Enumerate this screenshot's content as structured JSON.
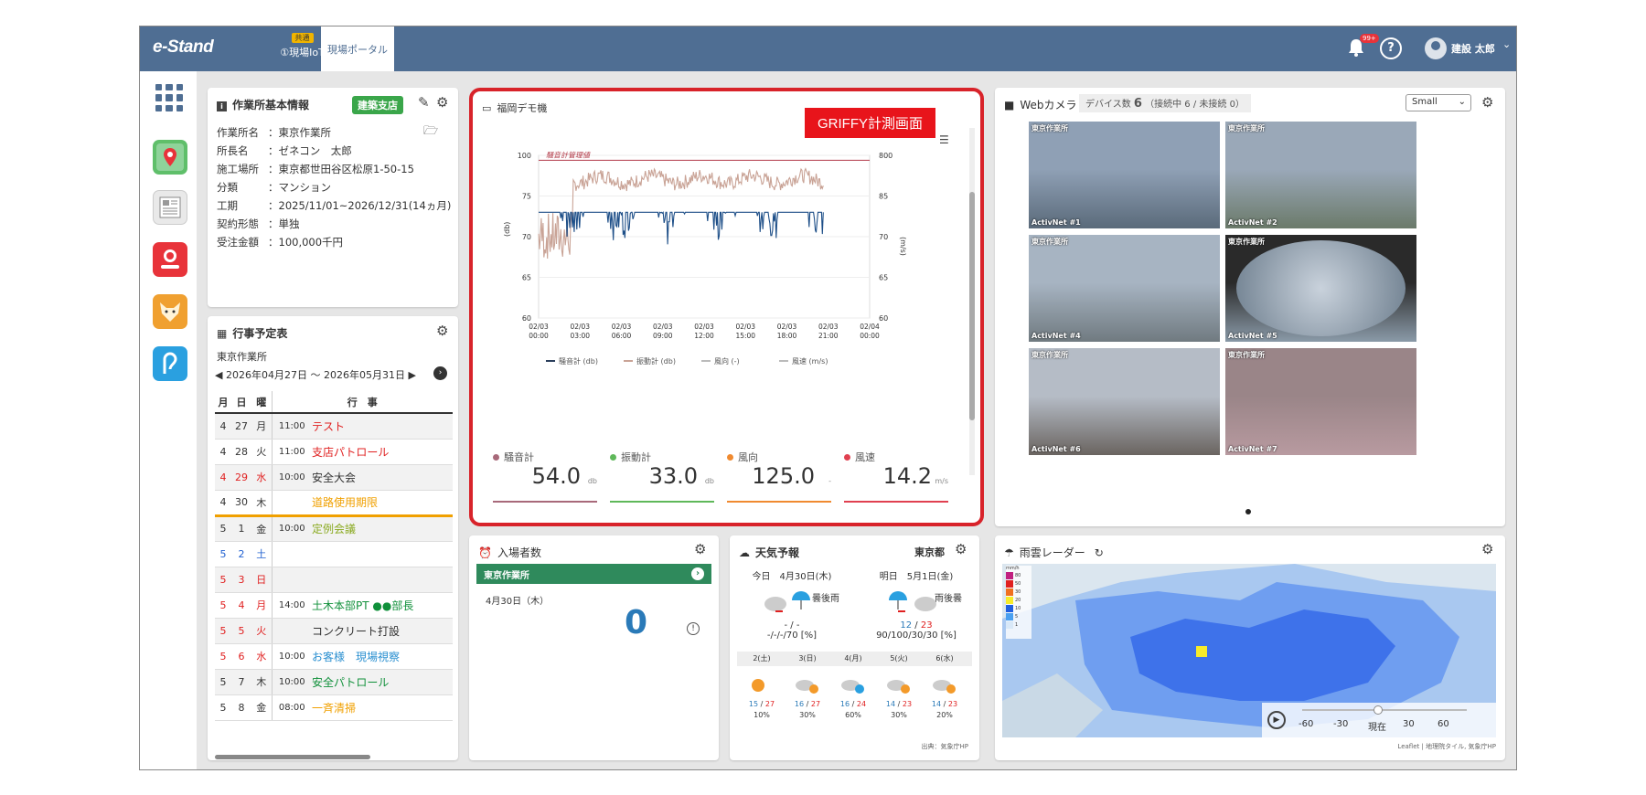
{
  "app": {
    "logo": "e-Stand"
  },
  "nav": {
    "tabs": [
      {
        "badge": "共通",
        "label": "①現場IoT"
      },
      {
        "label": "現場ポータル"
      }
    ],
    "notif_count": "99+",
    "help": "?",
    "user": "建設 太郎"
  },
  "info": {
    "title": "作業所基本情報",
    "tag": "建築支店",
    "rows": [
      {
        "k": "作業所名",
        "v": "東京作業所"
      },
      {
        "k": "所長名",
        "v": "ゼネコン　太郎"
      },
      {
        "k": "施工場所",
        "v": "東京都世田谷区松原1-50-15"
      },
      {
        "k": "分類",
        "v": "マンション"
      },
      {
        "k": "工期",
        "v": "2025/11/01~2026/12/31(14ヵ月)"
      },
      {
        "k": "契約形態",
        "v": "単独"
      },
      {
        "k": "受注金額",
        "v": "100,000千円"
      }
    ]
  },
  "schedule": {
    "title": "行事予定表",
    "site": "東京作業所",
    "range": "2026年04月27日 〜 2026年05月31日",
    "headers": [
      "月",
      "日",
      "曜",
      "行　事"
    ],
    "rows": [
      {
        "m": "4",
        "d": "27",
        "w": "月",
        "t": "11:00",
        "e": "テスト",
        "dc": "#333",
        "ec": "#e02020"
      },
      {
        "m": "4",
        "d": "28",
        "w": "火",
        "t": "11:00",
        "e": "支店パトロール",
        "dc": "#333",
        "ec": "#e02020"
      },
      {
        "m": "4",
        "d": "29",
        "w": "水",
        "t": "10:00",
        "e": "安全大会",
        "dc": "#e02020",
        "ec": "#333"
      },
      {
        "m": "4",
        "d": "30",
        "w": "木",
        "t": "",
        "e": "道路使用期限",
        "dc": "#333",
        "ec": "#f0a000"
      },
      {
        "m": "5",
        "d": "1",
        "w": "金",
        "t": "10:00",
        "e": "定例会議",
        "dc": "#333",
        "ec": "#8aaa20"
      },
      {
        "m": "5",
        "d": "2",
        "w": "土",
        "t": "",
        "e": "",
        "dc": "#2060d0",
        "ec": "#333"
      },
      {
        "m": "5",
        "d": "3",
        "w": "日",
        "t": "",
        "e": "",
        "dc": "#e02020",
        "ec": "#333"
      },
      {
        "m": "5",
        "d": "4",
        "w": "月",
        "t": "14:00",
        "e": "土木本部PT ●●部長",
        "dc": "#e02020",
        "ec": "#10903a"
      },
      {
        "m": "5",
        "d": "5",
        "w": "火",
        "t": "",
        "e": "コンクリート打設",
        "dc": "#e02020",
        "ec": "#333"
      },
      {
        "m": "5",
        "d": "6",
        "w": "水",
        "t": "10:00",
        "e": "お客様　現場視察",
        "dc": "#e02020",
        "ec": "#2a8fd0"
      },
      {
        "m": "5",
        "d": "7",
        "w": "木",
        "t": "10:00",
        "e": "安全パトロール",
        "dc": "#333",
        "ec": "#10903a"
      },
      {
        "m": "5",
        "d": "8",
        "w": "金",
        "t": "08:00",
        "e": "一斉清掃",
        "dc": "#333",
        "ec": "#f0a000"
      }
    ]
  },
  "griffy": {
    "title": "福岡デモ機",
    "overlay": "GRIFFY計測画面",
    "metrics": [
      {
        "name": "騒音計",
        "value": "54.0",
        "unit": "db",
        "color": "#a8697a"
      },
      {
        "name": "振動計",
        "value": "33.0",
        "unit": "db",
        "color": "#5fb85a"
      },
      {
        "name": "風向",
        "value": "125.0",
        "unit": "-",
        "color": "#f08a30"
      },
      {
        "name": "風速",
        "value": "14.2",
        "unit": "m/s",
        "color": "#e04050"
      }
    ]
  },
  "chart_data": {
    "type": "line",
    "x": [
      "02/03 00:00",
      "02/03 03:00",
      "02/03 06:00",
      "02/03 09:00",
      "02/03 12:00",
      "02/03 15:00",
      "02/03 18:00",
      "02/03 21:00",
      "02/04 00:00"
    ],
    "yleft": {
      "label": "(db)",
      "ticks": [
        60,
        65,
        70,
        75,
        100
      ]
    },
    "yright": {
      "label": "(m/s)",
      "ticks": [
        60,
        65,
        70,
        85,
        800
      ]
    },
    "threshold_label": "騒音計管理値",
    "threshold_value": 97,
    "legend": [
      "騒音計 (db)",
      "振動計 (db)",
      "風向 (-)",
      "風速 (m/s)"
    ],
    "series": [
      {
        "name": "騒音計 (db)",
        "color": "#c9a396",
        "base": 85,
        "amp": 9
      },
      {
        "name": "振動計 (db)",
        "color": "#1e4f88",
        "base": 76,
        "amp": 9
      }
    ]
  },
  "camera": {
    "title": "Webカメラ",
    "devices": "デバイス数",
    "count": "6",
    "conn": "（接続中 6 / 未接続 0）",
    "size": "Small",
    "tiles": [
      {
        "top": "東京作業所",
        "bottom": "ActivNet #1"
      },
      {
        "top": "東京作業所",
        "bottom": "ActivNet #2"
      },
      {
        "top": "東京作業所",
        "bottom": "ActivNet #4"
      },
      {
        "top": "東京作業所",
        "bottom": "ActivNet #5"
      },
      {
        "top": "東京作業所",
        "bottom": "ActivNet #6"
      },
      {
        "top": "東京作業所",
        "bottom": "ActivNet #7"
      }
    ]
  },
  "entry": {
    "title": "入場者数",
    "site": "東京作業所",
    "date": "4月30日（木）",
    "count": "0"
  },
  "weather": {
    "title": "天気予報",
    "location": "東京都",
    "today": {
      "label": "今日　4月30日(木)",
      "desc": "曇後雨",
      "temp": "- / -",
      "rain": "-/-/-/70 [%]"
    },
    "tomorrow": {
      "label": "明日　5月1日(金)",
      "desc": "雨後曇",
      "temp_lo": "12",
      "temp_hi": "23",
      "rain": "90/100/30/30 [%]"
    },
    "days": [
      {
        "d": "2(土)",
        "lo": "15",
        "hi": "27",
        "p": "10%"
      },
      {
        "d": "3(日)",
        "lo": "16",
        "hi": "27",
        "p": "30%"
      },
      {
        "d": "4(月)",
        "lo": "16",
        "hi": "24",
        "p": "60%"
      },
      {
        "d": "5(火)",
        "lo": "14",
        "hi": "23",
        "p": "30%"
      },
      {
        "d": "6(水)",
        "lo": "14",
        "hi": "23",
        "p": "20%"
      }
    ],
    "source": "出典：気象庁HP"
  },
  "radar": {
    "title": "雨雲レーダー",
    "legend_unit": "mm/h",
    "legend": [
      "80",
      "50",
      "30",
      "20",
      "10",
      "5",
      "1"
    ],
    "timeline": [
      "-60",
      "-30",
      "現在",
      "30",
      "60"
    ],
    "attrib": "Leaflet | 地理院タイル, 気象庁HP"
  }
}
